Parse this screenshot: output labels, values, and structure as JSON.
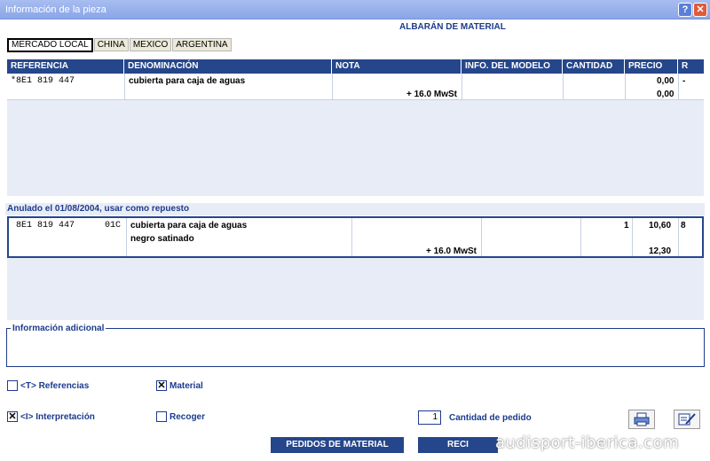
{
  "window": {
    "title": "Información de la pieza",
    "help_label": "?",
    "close_label": "✕"
  },
  "header": {
    "title": "ALBARÁN DE MATERIAL"
  },
  "tabs": [
    {
      "label": "MERCADO LOCAL",
      "active": true
    },
    {
      "label": "CHINA",
      "active": false
    },
    {
      "label": "MEXICO",
      "active": false
    },
    {
      "label": "ARGENTINA",
      "active": false
    }
  ],
  "table": {
    "columns": [
      "REFERENCIA",
      "DENOMINACIÓN",
      "NOTA",
      "INFO. DEL MODELO",
      "CANTIDAD",
      "PRECIO",
      "R"
    ],
    "row": {
      "referencia": "*8E1 819 447",
      "denominacion": "cubierta para caja de aguas",
      "nota": "+ 16.0 MwSt",
      "precio": "0,00",
      "precio_total": "0,00",
      "r": "-"
    }
  },
  "replacement": {
    "label": "Anulado el 01/08/2004, usar como repuesto",
    "row": {
      "referencia": "8E1 819 447",
      "codigo": "01C",
      "denominacion": "cubierta para caja de aguas",
      "denominacion2": "negro satinado",
      "nota": "+ 16.0 MwSt",
      "cantidad": "1",
      "precio": "10,60",
      "r": "8",
      "precio_total": "12,30"
    }
  },
  "info": {
    "label": "Información adicional"
  },
  "options": {
    "referencias": {
      "label": "<T> Referencias",
      "checked": false
    },
    "material": {
      "label": "Material",
      "checked": true
    },
    "interpretacion": {
      "label": "<I> Interpretación",
      "checked": true
    },
    "recoger": {
      "label": "Recoger",
      "checked": false
    }
  },
  "quantity": {
    "value": "1",
    "label": "Cantidad de pedido"
  },
  "buttons": {
    "pedidos": "PEDIDOS DE MATERIAL",
    "reci": "RECI"
  },
  "watermark": "audisport-iberica.com"
}
